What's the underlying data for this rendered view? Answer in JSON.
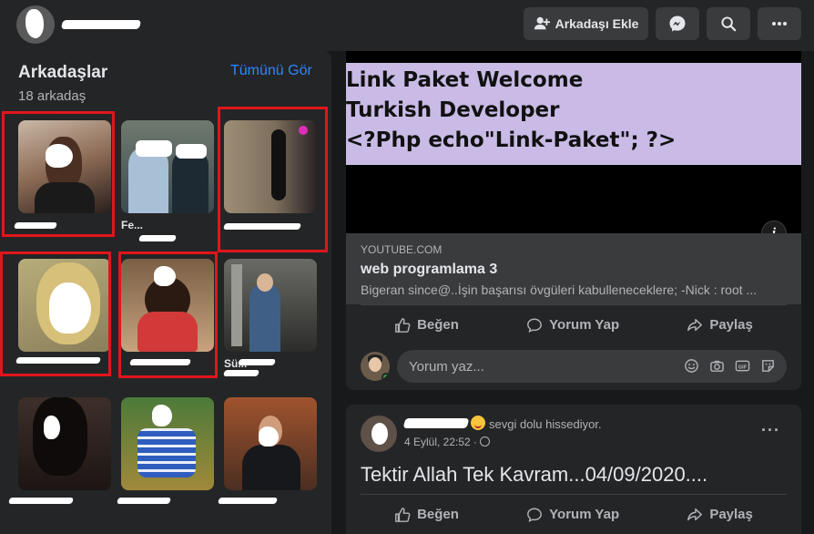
{
  "topbar": {
    "profile_name": "",
    "add_friend_label": "Arkadaşı Ekle",
    "icons": [
      "messenger-icon",
      "search-icon",
      "more-icon"
    ]
  },
  "friends": {
    "title": "Arkadaşlar",
    "count": "18 arkadaş",
    "see_all": "Tümünü Gör",
    "items": [
      {
        "name": ""
      },
      {
        "name": "Fe..."
      },
      {
        "name": ""
      },
      {
        "name": ""
      },
      {
        "name": ""
      },
      {
        "name": "Sü..."
      },
      {
        "name": ""
      },
      {
        "name": ""
      },
      {
        "name": ""
      }
    ]
  },
  "post1": {
    "thumbnail_lines": [
      "Link Paket Welcome",
      "Turkish Developer",
      "<?Php echo\"Link-Paket\"; ?>"
    ],
    "domain": "YOUTUBE.COM",
    "title": "web programlama 3",
    "description": "Bigeran since@..İşin başarısı övgüleri kabulleneceklere; -Nick : root ...",
    "actions": {
      "like": "Beğen",
      "comment": "Yorum Yap",
      "share": "Paylaş"
    },
    "comment_placeholder": "Yorum yaz..."
  },
  "post2": {
    "feeling": "sevgi dolu hissediyor.",
    "time": "4 Eylül, 22:52 ·",
    "text": "Tektir Allah Tek Kavram...04/09/2020....",
    "actions": {
      "like": "Beğen",
      "comment": "Yorum Yap",
      "share": "Paylaş"
    }
  },
  "colors": {
    "background": "#18191a",
    "card": "#242526",
    "accent_link": "#2d88ff",
    "highlight_box": "#e0161b",
    "thumbnail_banner": "#c9bbe6"
  }
}
